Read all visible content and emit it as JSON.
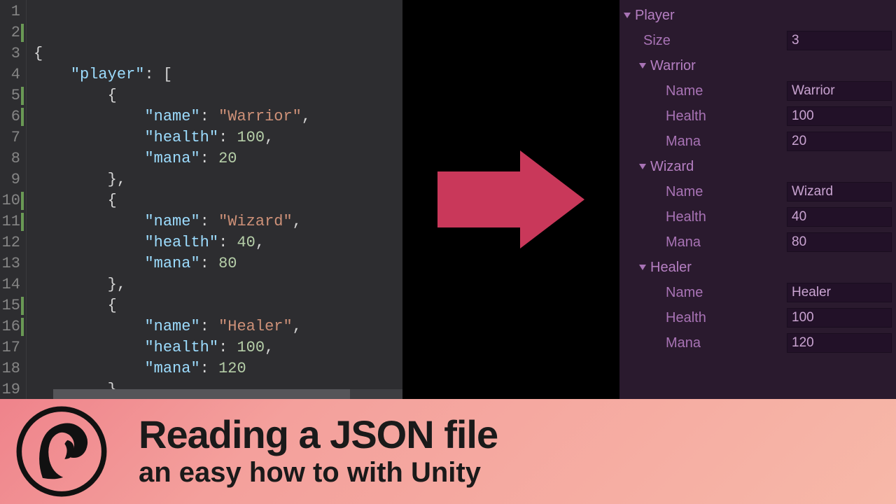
{
  "code": {
    "lines": [
      1,
      2,
      3,
      4,
      5,
      6,
      7,
      8,
      9,
      10,
      11,
      12,
      13,
      14,
      15,
      16,
      17,
      18,
      19
    ],
    "modifiedLines": [
      2,
      5,
      6,
      10,
      11,
      15,
      16
    ],
    "source": {
      "rootKey": "player",
      "items": [
        {
          "name": "Warrior",
          "health": 100,
          "mana": 20
        },
        {
          "name": "Wizard",
          "health": 40,
          "mana": 80
        },
        {
          "name": "Healer",
          "health": 100,
          "mana": 120
        }
      ],
      "keys": {
        "name": "name",
        "health": "health",
        "mana": "mana"
      }
    }
  },
  "inspector": {
    "rootLabel": "Player",
    "sizeLabel": "Size",
    "sizeValue": "3",
    "fields": {
      "name": "Name",
      "health": "Health",
      "mana": "Mana"
    },
    "items": [
      {
        "header": "Warrior",
        "name": "Warrior",
        "health": "100",
        "mana": "20"
      },
      {
        "header": "Wizard",
        "name": "Wizard",
        "health": "40",
        "mana": "80"
      },
      {
        "header": "Healer",
        "name": "Healer",
        "health": "100",
        "mana": "120"
      }
    ]
  },
  "banner": {
    "title": "Reading a JSON file",
    "subtitle": "an easy how to with Unity"
  }
}
